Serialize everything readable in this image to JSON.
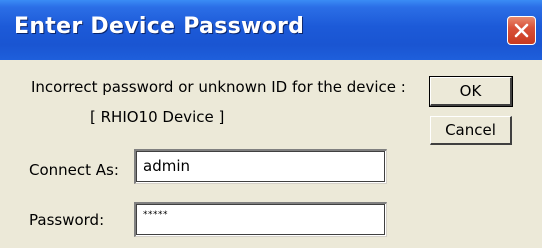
{
  "window": {
    "title": "Enter Device Password",
    "close_icon": "close-icon",
    "title_bar_color": "#1c5ad8",
    "close_button_color": "#c8391f"
  },
  "message": {
    "line1": "Incorrect password or unknown ID for the device :",
    "line2": "[ RHIO10 Device ]"
  },
  "form": {
    "connect_as_label": "Connect As:",
    "connect_as_value": "admin",
    "password_label": "Password:",
    "password_value": "*****"
  },
  "buttons": {
    "ok_label": "OK",
    "cancel_label": "Cancel"
  }
}
